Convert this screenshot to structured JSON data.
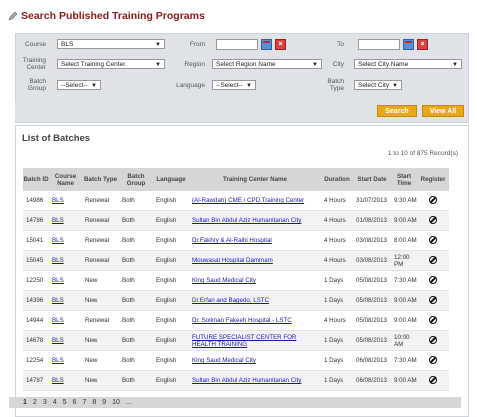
{
  "title": "Search Published Training Programs",
  "search": {
    "course_label": "Course",
    "course_value": "BLS",
    "from_label": "From",
    "to_label": "To",
    "training_center_label": "Training Center",
    "training_center_value": "Select Training Center",
    "region_label": "Region",
    "region_value": "Select Region Name",
    "city_label": "City",
    "city_value": "Select City Name",
    "batch_group_label": "Batch Group",
    "batch_group_value": "--Select--",
    "language_label": "Language",
    "language_value": "--Select--",
    "batch_type_label": "Batch Type",
    "batch_type_value": "Select City",
    "search_button": "Search",
    "view_all_button": "View All"
  },
  "batches": {
    "heading": "List of Batches",
    "record_info": "1 to 10 of 875 Record(s)",
    "columns": [
      "Batch ID",
      "Course Name",
      "Batch Type",
      "Batch Group",
      "Language",
      "Training Center Name",
      "Duration",
      "Start Date",
      "Start Time",
      "Register"
    ],
    "rows": [
      {
        "id": "14986",
        "course": "BLS",
        "type": "Renewal",
        "group": "Both",
        "lang": "English",
        "center": "(Al-Rawdah) CME / CPD Training Center",
        "duration": "4 Hours",
        "date": "31/07/2013",
        "time": "9:30 AM"
      },
      {
        "id": "14786",
        "course": "BLS",
        "type": "Renewal",
        "group": "Both",
        "lang": "English",
        "center": "Sultan Bin Abdul Aziz Humanitarian City",
        "duration": "4 Hours",
        "date": "01/08/2013",
        "time": "9:00 AM"
      },
      {
        "id": "15041",
        "course": "BLS",
        "type": "Renewal",
        "group": "Both",
        "lang": "English",
        "center": "Dr.Fakhry & Al-Raihi Hospital",
        "duration": "4 Hours",
        "date": "03/08/2013",
        "time": "8:00 AM"
      },
      {
        "id": "15045",
        "course": "BLS",
        "type": "Renewal",
        "group": "Both",
        "lang": "English",
        "center": "Mouwasat Hospital Dammam",
        "duration": "4 Hours",
        "date": "03/08/2013",
        "time": "12:00 PM"
      },
      {
        "id": "12250",
        "course": "BLS",
        "type": "New",
        "group": "Both",
        "lang": "English",
        "center": "King Saud Medical City",
        "duration": "1 Days",
        "date": "05/08/2013",
        "time": "7:30 AM"
      },
      {
        "id": "14396",
        "course": "BLS",
        "type": "New",
        "group": "Both",
        "lang": "English",
        "center": "Dr.Erfan and Bagedo, LSTC",
        "duration": "1 Days",
        "date": "05/08/2013",
        "time": "9:00 AM"
      },
      {
        "id": "14944",
        "course": "BLS",
        "type": "Renewal",
        "group": "Both",
        "lang": "English",
        "center": "Dr. Soliman Fakeeh Hospital - LSTC",
        "duration": "4 Hours",
        "date": "05/08/2013",
        "time": "9:00 AM"
      },
      {
        "id": "14678",
        "course": "BLS",
        "type": "New",
        "group": "Both",
        "lang": "English",
        "center": "FUTURE SPECIALIST CENTER FOR HEALTH TRAINING",
        "duration": "1 Days",
        "date": "05/08/2013",
        "time": "10:00 AM"
      },
      {
        "id": "12254",
        "course": "BLS",
        "type": "New",
        "group": "Both",
        "lang": "English",
        "center": "King Saud Medical City",
        "duration": "1 Days",
        "date": "06/08/2013",
        "time": "7:30 AM"
      },
      {
        "id": "14787",
        "course": "BLS",
        "type": "New",
        "group": "Both",
        "lang": "English",
        "center": "Sultan Bin Abdul Aziz Humanitarian City",
        "duration": "1 Days",
        "date": "06/08/2013",
        "time": "9:00 AM"
      }
    ]
  },
  "pager": {
    "pages": [
      "1",
      "2",
      "3",
      "4",
      "5",
      "6",
      "7",
      "8",
      "9",
      "10",
      "..."
    ]
  }
}
